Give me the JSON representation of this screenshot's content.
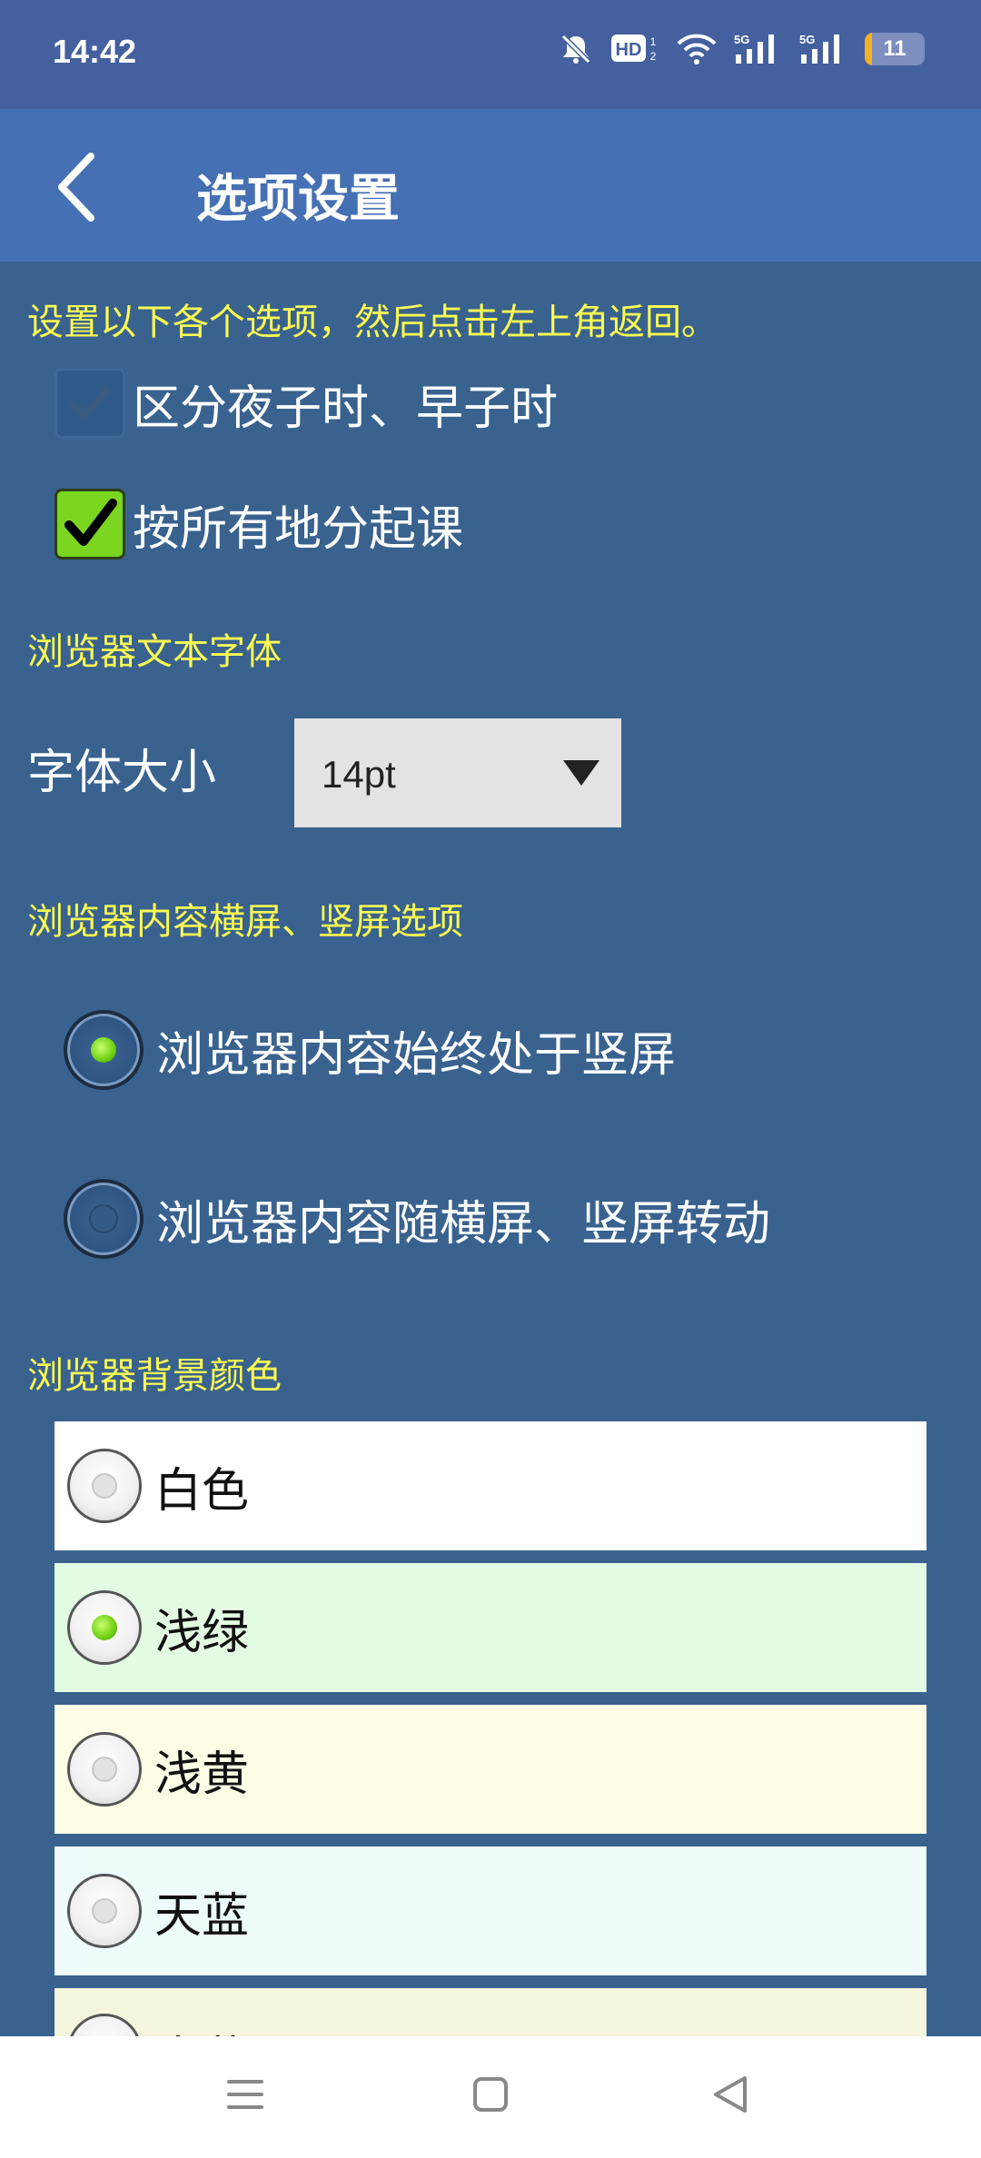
{
  "status_bar": {
    "time": "14:42",
    "icons": [
      "bell-off-icon",
      "hd-icon",
      "wifi-icon",
      "signal-5g-icon",
      "signal-5g-icon",
      "battery-icon"
    ],
    "battery_level": "11"
  },
  "app_bar": {
    "back_icon": "chevron-left-icon",
    "title": "选项设置"
  },
  "intro_text": "设置以下各个选项，然后点击左上角返回。",
  "checkboxes": [
    {
      "label": "区分夜子时、早子时",
      "checked": false
    },
    {
      "label": "按所有地分起课",
      "checked": true
    }
  ],
  "font_section": {
    "heading": "浏览器文本字体",
    "size_label": "字体大小",
    "size_value": "14pt"
  },
  "orientation_section": {
    "heading": "浏览器内容横屏、竖屏选项",
    "options": [
      {
        "label": "浏览器内容始终处于竖屏",
        "selected": true
      },
      {
        "label": "浏览器内容随横屏、竖屏转动",
        "selected": false
      }
    ]
  },
  "background_section": {
    "heading": "浏览器背景颜色",
    "options": [
      {
        "label": "白色",
        "bg": "#ffffff",
        "selected": false
      },
      {
        "label": "浅绿",
        "bg": "#e3fbe3",
        "selected": true
      },
      {
        "label": "浅黄",
        "bg": "#fffde6",
        "selected": false
      },
      {
        "label": "天蓝",
        "bg": "#eefcfc",
        "selected": false
      },
      {
        "label": "米黄",
        "bg": "#f5f5dc",
        "selected": false
      }
    ]
  },
  "nav_bar": {
    "buttons": [
      "menu-icon",
      "home-icon",
      "back-icon"
    ]
  },
  "colors": {
    "background": "#39628f",
    "app_bar": "#4570b3",
    "status_bar": "#44609e",
    "heading_yellow": "#fafa52",
    "check_green": "#7bd61f"
  }
}
